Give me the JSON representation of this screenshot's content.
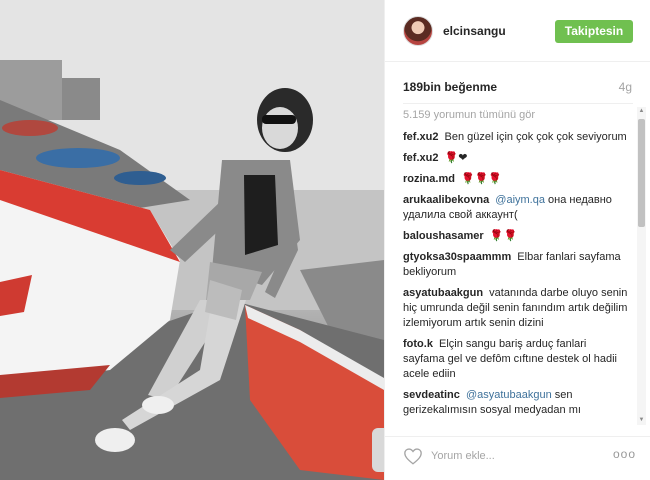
{
  "post": {
    "username": "elcinsangu",
    "follow_label": "Takiptesin",
    "likes": "189bin beğenme",
    "age": "4g",
    "view_all": "5.159 yorumun tümünü gör",
    "comments": [
      {
        "author": "fef.xu2",
        "text": "Ben güzel için çok çok çok seviyorum"
      },
      {
        "author": "fef.xu2",
        "text": "🌹❤"
      },
      {
        "author": "rozina.md",
        "text": "🌹🌹🌹"
      },
      {
        "author": "arukaalibekovna",
        "mention": "@aiym.qa",
        "text": "она недавно удалила свой аккаунт("
      },
      {
        "author": "baloushasamer",
        "text": "🌹🌹"
      },
      {
        "author": "gtyoksa30spaammm",
        "text": "Elbar fanlari sayfama bekliyorum"
      },
      {
        "author": "asyatubaakgun",
        "text": "vatanında darbe oluyo senin hiç umrunda değil senin fanındım artık değilim izlemiyorum artık senin dizini"
      },
      {
        "author": "foto.k",
        "text": "Elçin sangu bariş arduç fanlari sayfama gel ve defôm cıftıne destek ol hadii acele ediin"
      },
      {
        "author": "sevdeatinc",
        "mention": "@asyatubaakgun",
        "text": "sen gerizekalımısın sosyal medyadan mı"
      }
    ],
    "comment_placeholder": "Yorum ekle...",
    "more_label": "ooo"
  },
  "icons": {
    "heart": "heart-outline-icon",
    "more": "more-options-icon",
    "next": "carousel-next-arrow"
  },
  "colors": {
    "follow_button": "#70c050",
    "mention": "#3f729b",
    "muted_text": "#a5a5a5"
  }
}
